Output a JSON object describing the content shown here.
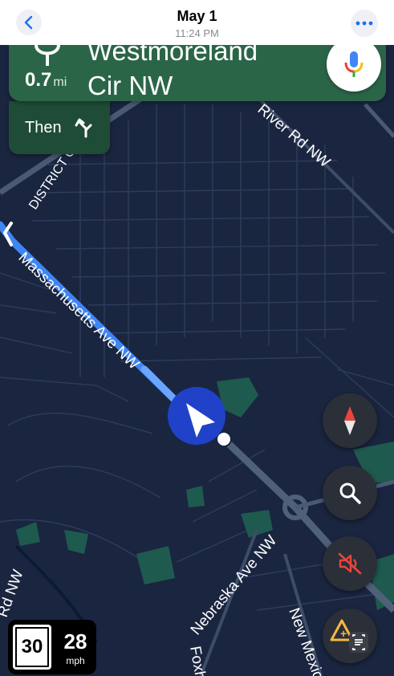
{
  "topbar": {
    "date": "May 1",
    "time": "11:24 PM"
  },
  "navigation": {
    "distance_value": "0.7",
    "distance_unit": "mi",
    "street_line1": "Westmoreland",
    "street_line2": "Cir NW",
    "then_label": "Then"
  },
  "map": {
    "street_labels": [
      "River Rd NW",
      "DISTRICT OF COLUMBIA",
      "Massachusetts Ave NW",
      "Nebraska Ave NW",
      "Rd NW",
      "Foxh",
      "New Mexic"
    ]
  },
  "speed": {
    "limit": "30",
    "current": "28",
    "unit": "mph"
  },
  "icons": {
    "back": "chevron-left-icon",
    "more": "ellipsis-icon",
    "mic": "microphone-icon",
    "compass": "compass-icon",
    "search": "search-icon",
    "mute": "sound-off-icon",
    "report": "report-incident-icon"
  },
  "colors": {
    "map_background": "#1a2540",
    "nav_card": "#2b6548",
    "route": "#3f86f5",
    "location_puck": "#2042c8"
  }
}
